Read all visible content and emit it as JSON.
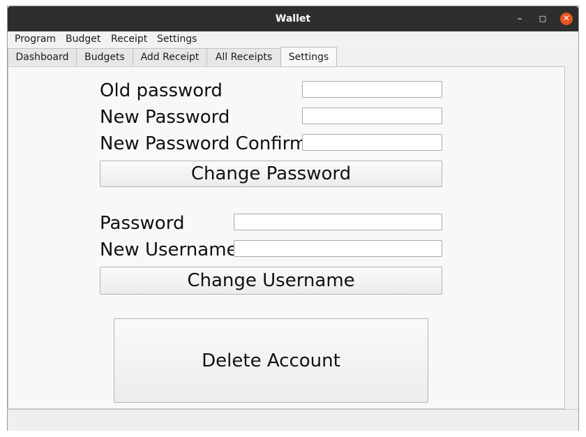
{
  "window": {
    "title": "Wallet",
    "minimize_glyph": "–",
    "maximize_glyph": "□",
    "close_glyph": "✕"
  },
  "menubar": {
    "items": [
      "Program",
      "Budget",
      "Receipt",
      "Settings"
    ]
  },
  "tabs": {
    "items": [
      "Dashboard",
      "Budgets",
      "Add Receipt",
      "All Receipts",
      "Settings"
    ],
    "active": "Settings"
  },
  "change_password": {
    "old_password_label": "Old password",
    "old_password_value": "",
    "new_password_label": "New Password",
    "new_password_value": "",
    "confirm_label": "New Password Confirm",
    "confirm_value": "",
    "button_label": "Change Password"
  },
  "change_username": {
    "password_label": "Password",
    "password_value": "",
    "new_username_label": "New Username",
    "new_username_value": "",
    "button_label": "Change Username"
  },
  "delete_account": {
    "button_label": "Delete Account"
  },
  "colors": {
    "titlebar": "#2e2e2e",
    "close_button": "#e95420"
  }
}
